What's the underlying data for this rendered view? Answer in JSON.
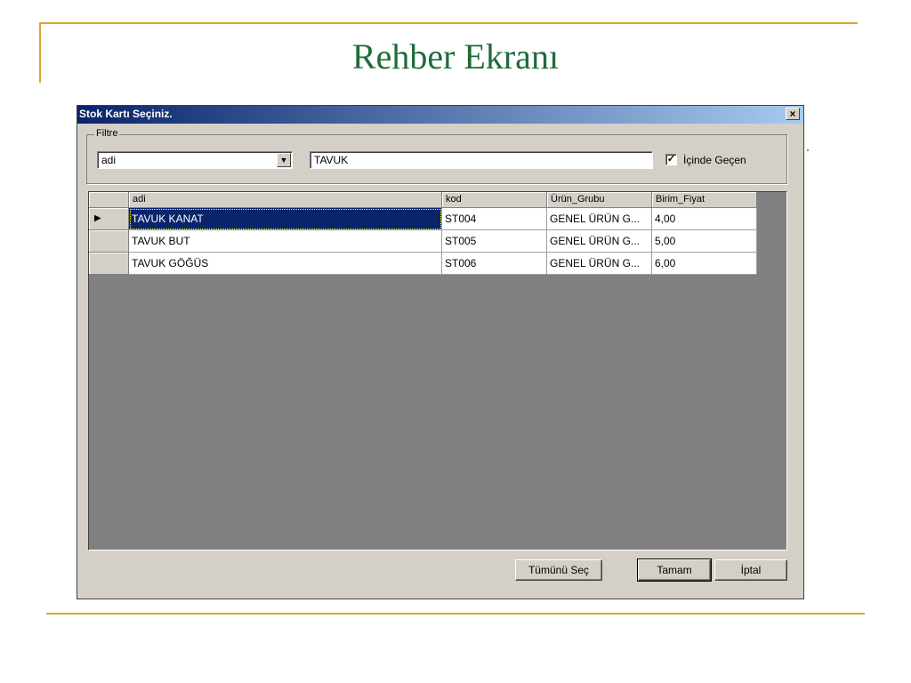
{
  "slide": {
    "title": "Rehber Ekranı",
    "accent_color": "#d9a52f",
    "title_color": "#1f6b3a"
  },
  "dialog": {
    "title": "Stok Kartı Seçiniz.",
    "close_label": "×",
    "filter": {
      "legend": "Filtre",
      "field_select_value": "adi",
      "search_value": "TAVUK",
      "contains_checked": true,
      "contains_label": "İçinde Geçen"
    },
    "grid": {
      "columns": [
        "adi",
        "kod",
        "Ürün_Grubu",
        "Birim_Fiyat"
      ],
      "selected_row_index": 0,
      "rows": [
        {
          "adi": "TAVUK KANAT",
          "kod": "ST004",
          "urun_grubu": "GENEL ÜRÜN G...",
          "birim_fiyat": "4,00"
        },
        {
          "adi": "TAVUK BUT",
          "kod": "ST005",
          "urun_grubu": "GENEL ÜRÜN G...",
          "birim_fiyat": "5,00"
        },
        {
          "adi": "TAVUK GÖĞÜS",
          "kod": "ST006",
          "urun_grubu": "GENEL ÜRÜN G...",
          "birim_fiyat": "6,00"
        }
      ],
      "selection_color": "#0a246a"
    },
    "buttons": {
      "select_all": "Tümünü Seç",
      "ok": "Tamam",
      "cancel": "İptal"
    }
  }
}
